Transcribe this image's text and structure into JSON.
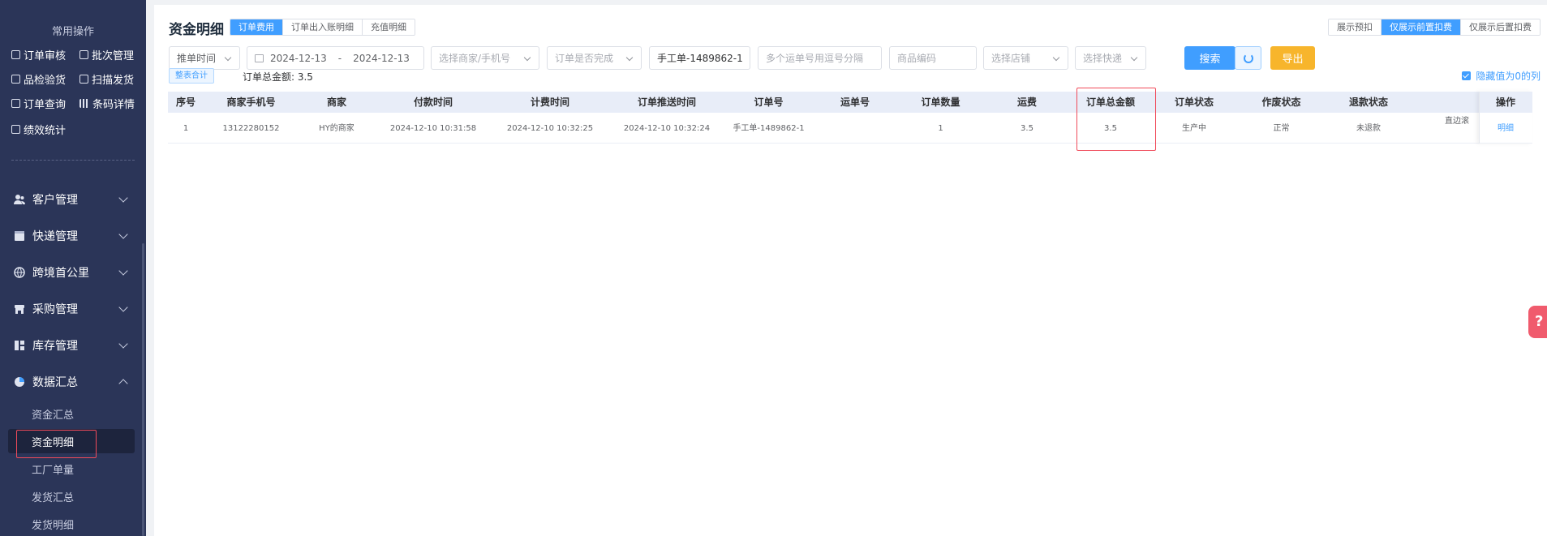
{
  "sidebar": {
    "common_title": "常用操作",
    "quick_links": [
      {
        "label": "订单审核"
      },
      {
        "label": "批次管理"
      },
      {
        "label": "品检验货"
      },
      {
        "label": "扫描发货"
      },
      {
        "label": "订单查询"
      },
      {
        "label": "条码详情"
      },
      {
        "label": "绩效统计"
      }
    ],
    "menus": [
      {
        "label": "客户管理",
        "icon": "users-icon"
      },
      {
        "label": "快递管理",
        "icon": "box-icon"
      },
      {
        "label": "跨境首公里",
        "icon": "globe-icon"
      },
      {
        "label": "采购管理",
        "icon": "store-icon"
      },
      {
        "label": "库存管理",
        "icon": "warehouse-icon"
      },
      {
        "label": "数据汇总",
        "icon": "pie-chart-icon"
      }
    ],
    "submenu": [
      {
        "label": "资金汇总"
      },
      {
        "label": "资金明细"
      },
      {
        "label": "工厂单量"
      },
      {
        "label": "发货汇总"
      },
      {
        "label": "发货明细"
      }
    ]
  },
  "header": {
    "title": "资金明细",
    "tabs": [
      "订单费用",
      "订单出入账明细",
      "充值明细"
    ],
    "view_toggle": [
      "展示预扣",
      "仅展示前置扣费",
      "仅展示后置扣费"
    ]
  },
  "filters": {
    "time_type": "推单时间",
    "date_start": "2024-12-13",
    "date_sep": "-",
    "date_end": "2024-12-13",
    "merchant_placeholder": "选择商家/手机号",
    "completed_placeholder": "订单是否完成",
    "order_no_value": "手工单-1489862-1",
    "tracking_placeholder": "多个运单号用逗号分隔",
    "sku_placeholder": "商品编码",
    "shop_placeholder": "选择店铺",
    "express_placeholder": "选择快递",
    "search_label": "搜索",
    "export_label": "导出"
  },
  "summary": {
    "tag_label": "整表合计",
    "total_label": "订单总金额: 3.5",
    "hide_zero_label": "隐藏值为0的列"
  },
  "table": {
    "columns": [
      "序号",
      "商家手机号",
      "商家",
      "付款时间",
      "计费时间",
      "订单推送时间",
      "订单号",
      "运单号",
      "订单数量",
      "运费",
      "订单总金额",
      "订单状态",
      "作废状态",
      "退款状态",
      "操作"
    ],
    "rows": [
      {
        "index": "1",
        "phone": "13122280152",
        "merchant": "HY的商家",
        "pay_time": "2024-12-10 10:31:58",
        "bill_time": "2024-12-10 10:32:25",
        "push_time": "2024-12-10 10:32:24",
        "order_no": "手工单-1489862-1",
        "tracking_no": "",
        "qty": "1",
        "freight": "3.5",
        "total": "3.5",
        "order_status": "生产中",
        "void_status": "正常",
        "refund_status": "未退款",
        "extra": "直边滚",
        "action": "明细"
      }
    ]
  },
  "help_label": "?",
  "colors": {
    "sidebar_bg": "#2b3558",
    "primary": "#409eff",
    "warning": "#f7b52c",
    "highlight": "#f04a5a"
  }
}
